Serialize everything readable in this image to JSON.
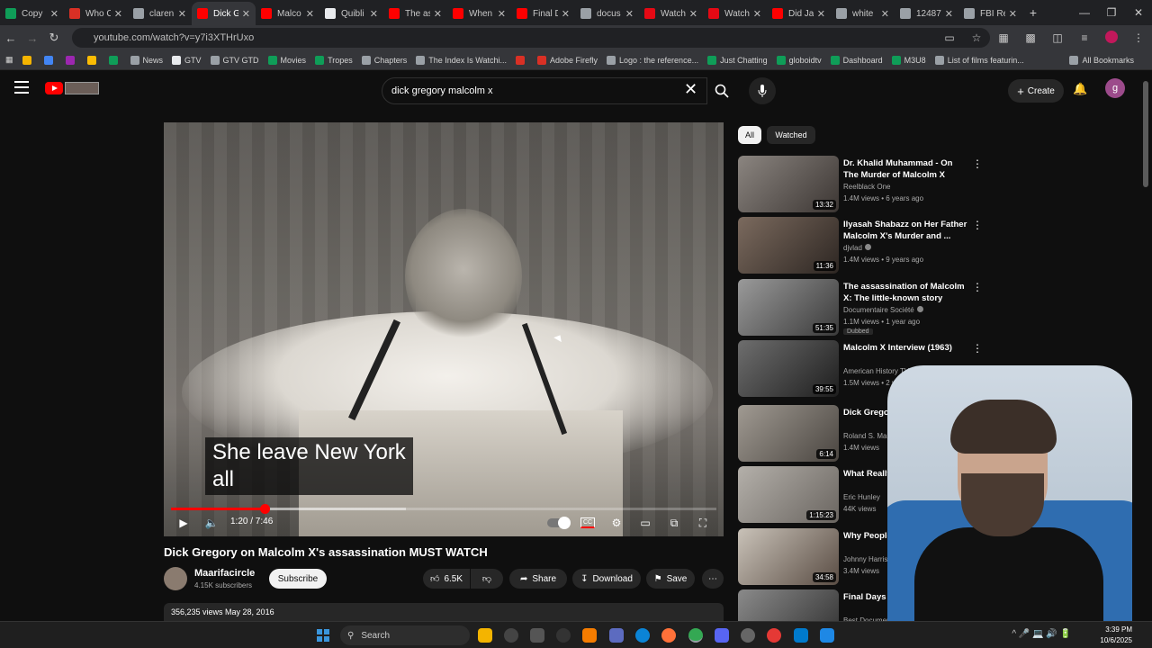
{
  "browser": {
    "tabs": [
      {
        "title": "Copy",
        "color": "#0f9d58"
      },
      {
        "title": "Who C",
        "color": "#d93025"
      },
      {
        "title": "claren",
        "color": "#9aa0a6"
      },
      {
        "title": "Dick G",
        "color": "#ff0000"
      },
      {
        "title": "Malco",
        "color": "#ff0000"
      },
      {
        "title": "Quibli",
        "color": "#e8eaed"
      },
      {
        "title": "The as",
        "color": "#ff0000"
      },
      {
        "title": "When",
        "color": "#ff0000"
      },
      {
        "title": "Final D",
        "color": "#ff0000"
      },
      {
        "title": "docus",
        "color": "#9aa0a6"
      },
      {
        "title": "Watch",
        "color": "#e50914"
      },
      {
        "title": "Watch",
        "color": "#e50914"
      },
      {
        "title": "Did Ja",
        "color": "#ff0000"
      },
      {
        "title": "white",
        "color": "#9aa0a6"
      },
      {
        "title": "12487",
        "color": "#9aa0a6"
      },
      {
        "title": "FBI Re",
        "color": "#9aa0a6"
      }
    ],
    "active_tab_index": 3,
    "url": "youtube.com/watch?v=y7i3XTHrUxo",
    "bookmarks": [
      {
        "label": "",
        "color": "#f4b400"
      },
      {
        "label": "",
        "color": "#4285f4"
      },
      {
        "label": "",
        "color": "#9c27b0"
      },
      {
        "label": "",
        "color": "#fbbc04"
      },
      {
        "label": "",
        "color": "#0f9d58"
      },
      {
        "label": "News",
        "color": "#9aa0a6"
      },
      {
        "label": "GTV",
        "color": "#e8eaed"
      },
      {
        "label": "GTV GTD",
        "color": "#9aa0a6"
      },
      {
        "label": "Movies",
        "color": "#0f9d58"
      },
      {
        "label": "Tropes",
        "color": "#0f9d58"
      },
      {
        "label": "Chapters",
        "color": "#9aa0a6"
      },
      {
        "label": "The Index Is Watchi...",
        "color": "#9aa0a6"
      },
      {
        "label": "",
        "color": "#d93025"
      },
      {
        "label": "Adobe Firefly",
        "color": "#d93025"
      },
      {
        "label": "Logo : the reference...",
        "color": "#9aa0a6"
      },
      {
        "label": "Just Chatting",
        "color": "#0f9d58"
      },
      {
        "label": "globoidtv",
        "color": "#0f9d58"
      },
      {
        "label": "Dashboard",
        "color": "#0f9d58"
      },
      {
        "label": "M3U8",
        "color": "#0f9d58"
      },
      {
        "label": "List of films featurin...",
        "color": "#9aa0a6"
      }
    ],
    "all_bookmarks_label": "All Bookmarks"
  },
  "youtube": {
    "search_query": "dick gregory malcolm x",
    "create_label": "Create",
    "avatar_letter": "g",
    "video": {
      "caption": "She leave New York\nall",
      "current_time": "1:20",
      "duration": "7:46",
      "time_display": "1:20 / 7:46",
      "progress_fraction": 0.172,
      "buffered_fraction": 0.43,
      "title": "Dick Gregory on Malcolm X's assassination MUST WATCH",
      "channel": "Maarifacircle",
      "subscribers": "4.15K subscribers",
      "subscribe_label": "Subscribe",
      "likes": "6.5K",
      "share_label": "Share",
      "download_label": "Download",
      "save_label": "Save",
      "views": "356,235 views",
      "date": "May 28, 2016",
      "views_line": "356,235 views  May 28, 2016"
    },
    "chips": {
      "all": "All",
      "watched": "Watched"
    },
    "recommendations": [
      {
        "title": "Dr. Khalid Muhammad - On The Murder of Malcolm X (1995)",
        "channel": "Reelblack One",
        "meta": "1.4M views • 6 years ago",
        "duration": "13:32",
        "verified": false,
        "badge": ""
      },
      {
        "title": "Ilyasah Shabazz on Her Father Malcolm X's Murder and ...",
        "channel": "djvlad",
        "meta": "1.4M views • 9 years ago",
        "duration": "11:36",
        "verified": true,
        "badge": ""
      },
      {
        "title": "The assassination of Malcolm X: The little-known story",
        "channel": "Documentaire Société",
        "meta": "1.1M views • 1 year ago",
        "duration": "51:35",
        "verified": true,
        "badge": "Dubbed"
      },
      {
        "title": "Malcolm X Interview (1963)",
        "channel": "American History TV C-SPAN",
        "meta": "1.5M views • 2 years ago",
        "duration": "39:55",
        "verified": false,
        "badge": ""
      },
      {
        "title": "Dick Gregory About Poten",
        "channel": "Roland S. Mar",
        "meta": "1.4M views",
        "duration": "6:14",
        "verified": false,
        "badge": ""
      },
      {
        "title": "What Really Oklahoma C",
        "channel": "Eric Hunley",
        "meta": "44K views",
        "duration": "1:15:23",
        "verified": false,
        "badge": ""
      },
      {
        "title": "Why People MLK",
        "channel": "Johnny Harris",
        "meta": "3.4M views",
        "duration": "34:58",
        "verified": false,
        "badge": ""
      },
      {
        "title": "Final Days of An Ic",
        "channel": "Best Documentary",
        "meta": "",
        "duration": "",
        "verified": true,
        "badge": ""
      }
    ]
  },
  "taskbar": {
    "search_label": "Search",
    "time": "3:39 PM",
    "date": "10/6/2025"
  },
  "colors": {
    "accent": "#ff0000",
    "background": "#0f0f0f",
    "taskbar": "#1f1f1f"
  }
}
